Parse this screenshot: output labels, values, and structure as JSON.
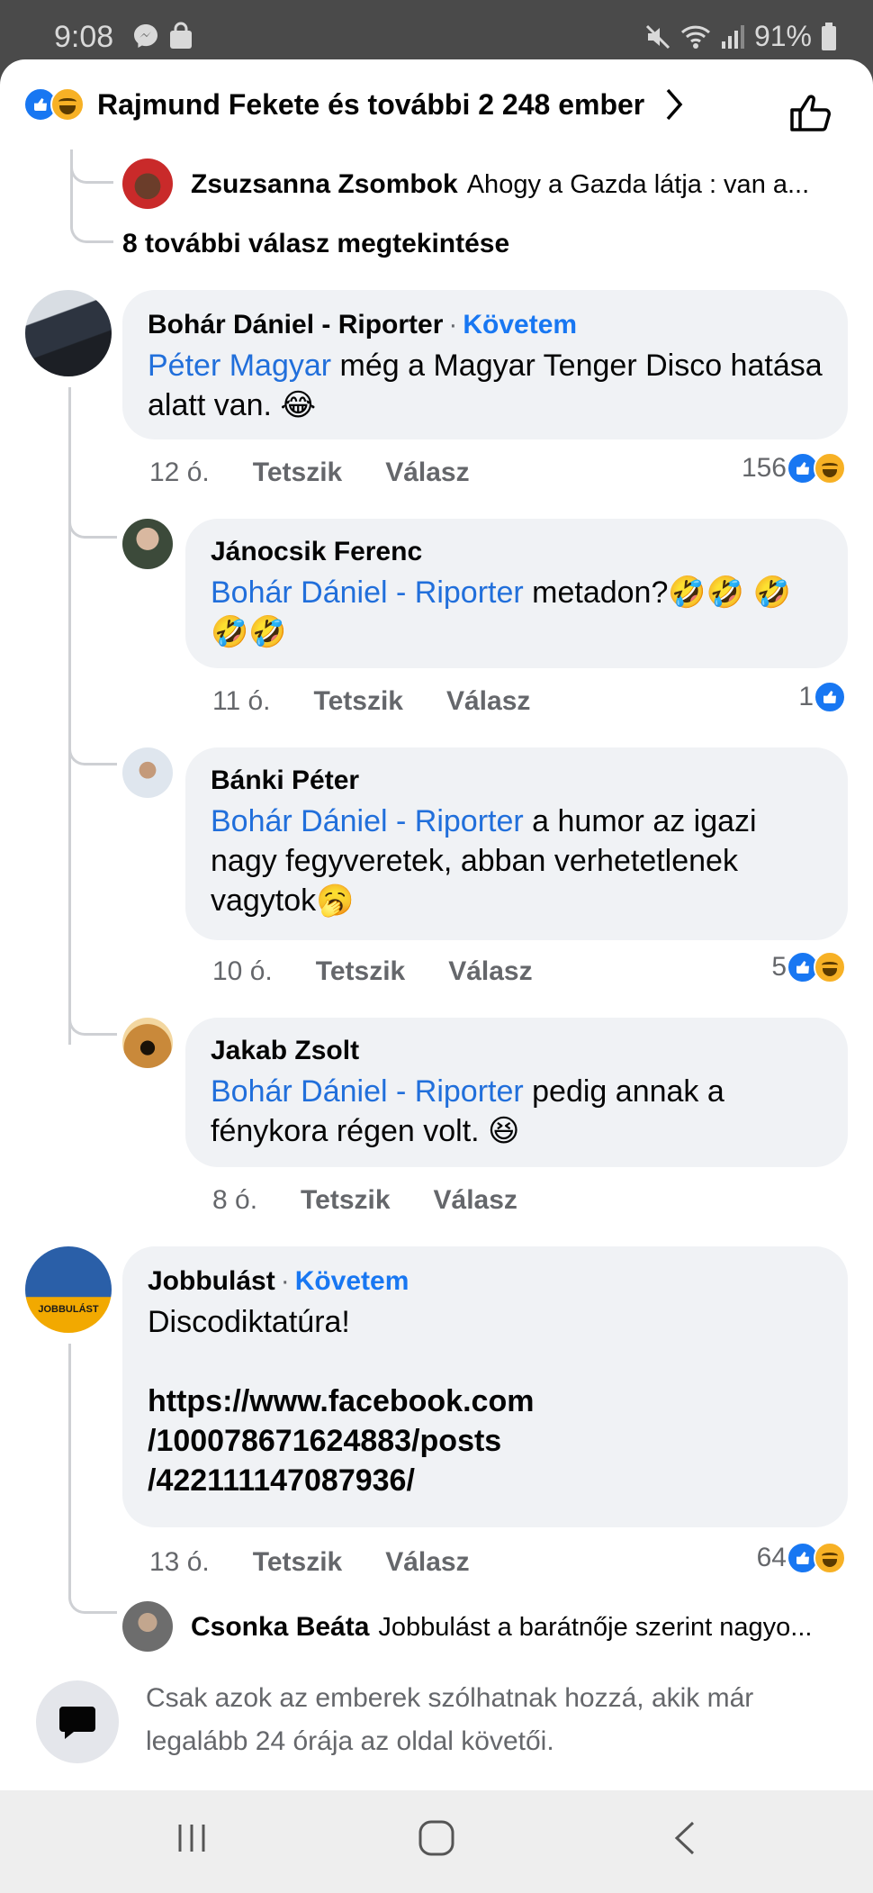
{
  "status_bar": {
    "time": "9:08",
    "battery": "91%"
  },
  "header": {
    "reactions_text": "Rajmund Fekete és további 2 248 ember"
  },
  "collapsed_top": {
    "name": "Zsuzsanna Zsombok",
    "preview": "Ahogy a Gazda látja : van a..."
  },
  "more_replies": "8 további válasz megtekintése",
  "comments": [
    {
      "name": "Bohár Dániel - Riporter",
      "follow": "Követem",
      "mention": "Péter Magyar",
      "text": " még a Magyar Tenger Disco hatása alatt van. 😂",
      "time": "12 ó.",
      "like": "Tetszik",
      "reply": "Válasz",
      "count": "156"
    },
    {
      "name": "Jánocsik Ferenc",
      "mention": "Bohár Dániel - Riporter",
      "text": " metadon?🤣🤣 🤣🤣🤣",
      "time": "11 ó.",
      "like": "Tetszik",
      "reply": "Válasz",
      "count": "1"
    },
    {
      "name": "Bánki Péter",
      "mention": "Bohár Dániel - Riporter",
      "text": " a humor az igazi nagy fegyveretek, abban verhetetlenek vagytok🥱",
      "time": "10 ó.",
      "like": "Tetszik",
      "reply": "Válasz",
      "count": "5"
    },
    {
      "name": "Jakab Zsolt",
      "mention": "Bohár Dániel - Riporter",
      "text": " pedig annak a fénykora régen volt. 😆",
      "time": "8 ó.",
      "like": "Tetszik",
      "reply": "Válasz"
    },
    {
      "name": "Jobbulást",
      "follow": "Követem",
      "text": "Discodiktatúra!",
      "link": [
        "https://www.facebook.com",
        "/100078671624883/posts",
        "/422111147087936/"
      ],
      "time": "13 ó.",
      "like": "Tetszik",
      "reply": "Válasz",
      "count": "64",
      "avatar_label": "JOBBULÁST"
    }
  ],
  "collapsed_bottom": {
    "name": "Csonka Beáta",
    "preview": "Jobbulást a barátnője szerint nagyo..."
  },
  "composer": {
    "notice": "Csak azok az emberek szólhatnak hozzá, akik már legalább 24 órája az oldal követői."
  },
  "colors": {
    "like_blue": "#1877f2",
    "link_blue": "#216fdb",
    "haha_yellow": "#f7b125",
    "bubble": "#f0f2f5"
  }
}
